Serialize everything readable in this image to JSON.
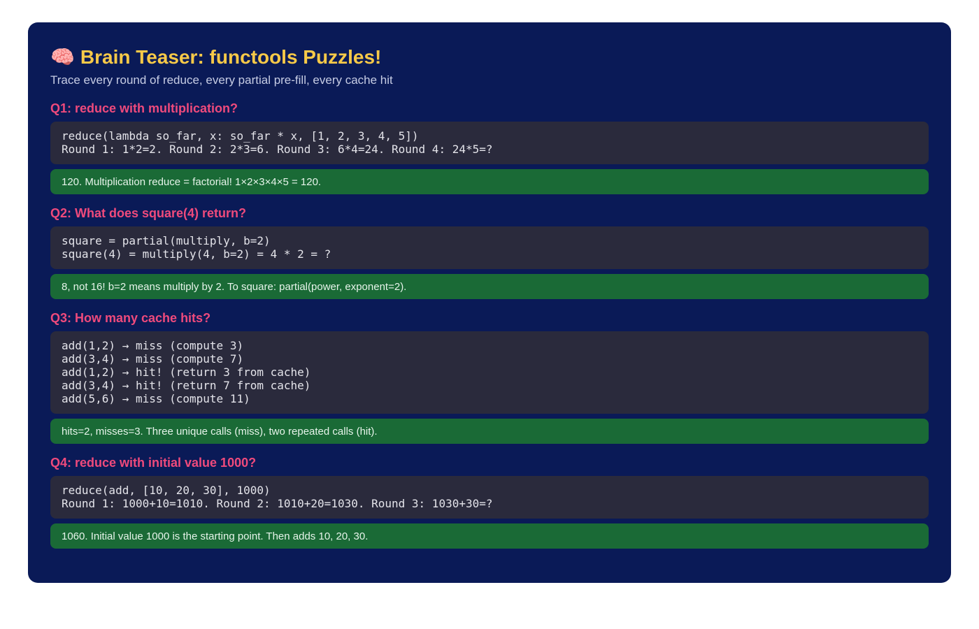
{
  "header": {
    "emoji": "🧠",
    "title": "Brain Teaser: functools Puzzles!",
    "subtitle": "Trace every round of reduce, every partial pre-fill, every cache hit"
  },
  "questions": [
    {
      "heading": "Q1: reduce with multiplication?",
      "code": [
        "reduce(lambda so_far, x: so_far * x, [1, 2, 3, 4, 5])",
        "Round 1: 1*2=2. Round 2: 2*3=6. Round 3: 6*4=24. Round 4: 24*5=?"
      ],
      "answer": "120. Multiplication reduce = factorial! 1×2×3×4×5 = 120."
    },
    {
      "heading": "Q2: What does square(4) return?",
      "code": [
        "square = partial(multiply, b=2)",
        "square(4) = multiply(4, b=2) = 4 * 2 = ?"
      ],
      "answer": "8, not 16! b=2 means multiply by 2. To square: partial(power, exponent=2)."
    },
    {
      "heading": "Q3: How many cache hits?",
      "code": [
        "add(1,2) → miss (compute 3)",
        "add(3,4) → miss (compute 7)",
        "add(1,2) → hit! (return 3 from cache)",
        "add(3,4) → hit! (return 7 from cache)",
        "add(5,6) → miss (compute 11)"
      ],
      "answer": "hits=2, misses=3. Three unique calls (miss), two repeated calls (hit)."
    },
    {
      "heading": "Q4: reduce with initial value 1000?",
      "code": [
        "reduce(add, [10, 20, 30], 1000)",
        "Round 1: 1000+10=1010. Round 2: 1010+20=1030. Round 3: 1030+30=?"
      ],
      "answer": "1060. Initial value 1000 is the starting point. Then adds 10, 20, 30."
    }
  ]
}
